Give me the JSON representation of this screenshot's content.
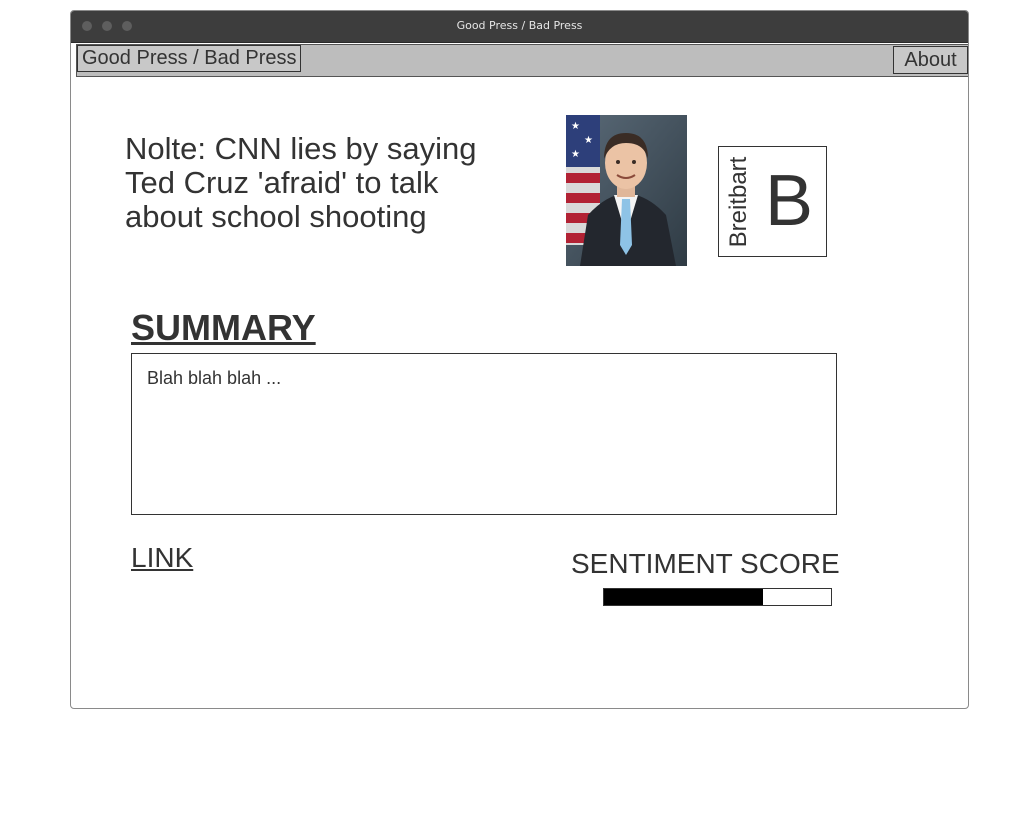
{
  "window": {
    "title": "Good Press / Bad Press"
  },
  "navbar": {
    "brand": "Good Press / Bad Press",
    "about": "About"
  },
  "article": {
    "headline": "Nolte: CNN lies by saying Ted Cruz 'afraid' to talk about school shooting",
    "photo_icon": "person-portrait-photo",
    "source_name": "Breitbart",
    "source_grade": "B"
  },
  "summary": {
    "heading": "SUMMARY",
    "text": "Blah blah blah ..."
  },
  "link": {
    "label": "LINK"
  },
  "sentiment": {
    "label": "SENTIMENT SCORE",
    "score_fraction": 0.7
  },
  "colors": {
    "titlebar": "#3d3d3d",
    "navbar": "#bdbdbd",
    "text": "#333333",
    "sentiment_fill": "#000000"
  }
}
